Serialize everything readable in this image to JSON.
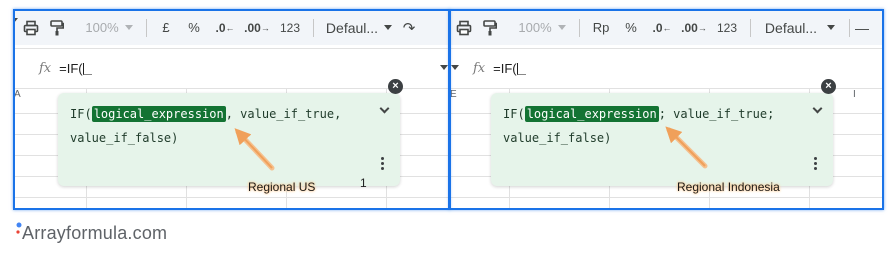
{
  "left_panel": {
    "toolbar": {
      "zoom": "100%",
      "currency": "£",
      "percent": "%",
      "decrease_decimal": ".0",
      "increase_decimal": ".00",
      "number_format": "123",
      "font": "Defaul..."
    },
    "formula": "=IF(",
    "column_letter": "A",
    "helper": {
      "fn_open": "IF(",
      "highlight_arg": "logical_expression",
      "rest_line1": ", value_if_true,",
      "line2": "value_if_false)"
    },
    "annotation": "Regional US",
    "cell_value": "1"
  },
  "right_panel": {
    "toolbar": {
      "zoom": "100%",
      "currency": "Rp",
      "percent": "%",
      "decrease_decimal": ".0",
      "increase_decimal": ".00",
      "number_format": "123",
      "font": "Defaul..."
    },
    "formula": "=IF(",
    "column_letter": "E",
    "column_letter_2": "I",
    "helper": {
      "fn_open": "IF(",
      "highlight_arg": "logical_expression",
      "rest_line1": "; value_if_true;",
      "line2": "value_if_false)"
    },
    "annotation": "Regional Indonesia"
  },
  "brand": {
    "name": "Arrayformula.com"
  },
  "colors": {
    "frame": "#1a73e8",
    "helper_bg": "#e6f4ea",
    "highlight": "#137333",
    "arrow": "#f0a05a"
  },
  "icons": [
    "print-icon",
    "paint-format-icon",
    "redo-icon",
    "fx-icon",
    "close-icon",
    "chevron-down-icon",
    "more-vert-icon",
    "arrow-annotation-icon",
    "brand-logo-icon"
  ]
}
